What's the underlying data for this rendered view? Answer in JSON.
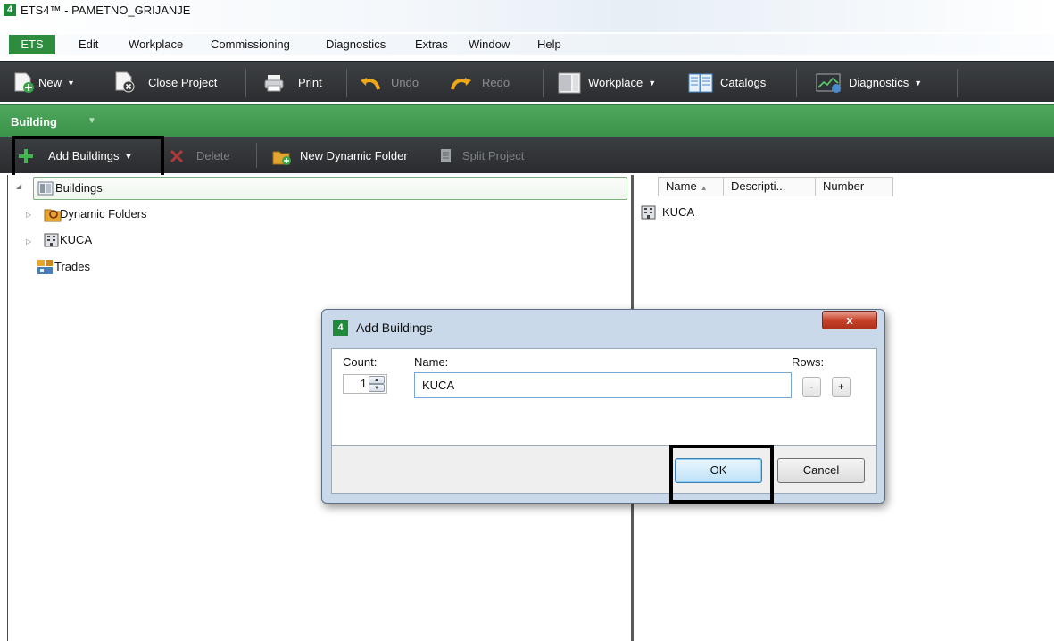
{
  "window": {
    "title": "ETS4™ - PAMETNO_GRIJANJE",
    "logo": "4"
  },
  "menu": {
    "ets_label": "ETS",
    "items": [
      "Edit",
      "Workplace",
      "Commissioning",
      "Diagnostics",
      "Extras",
      "Window",
      "Help"
    ]
  },
  "toolbar": {
    "new_label": "New",
    "close_project_label": "Close Project",
    "print_label": "Print",
    "undo_label": "Undo",
    "redo_label": "Redo",
    "workplace_label": "Workplace",
    "catalogs_label": "Catalogs",
    "diagnostics_label": "Diagnostics"
  },
  "section": {
    "title": "Building"
  },
  "subtoolbar": {
    "add_buildings_label": "Add Buildings",
    "delete_label": "Delete",
    "new_dynamic_folder_label": "New Dynamic Folder",
    "split_project_label": "Split Project"
  },
  "tree": {
    "root_label": "Buildings",
    "items": [
      {
        "label": "Dynamic Folders"
      },
      {
        "label": "KUCA"
      },
      {
        "label": "Trades"
      }
    ]
  },
  "list": {
    "columns": [
      "Name",
      "Descripti...",
      "Number"
    ],
    "rows": [
      {
        "name": "KUCA"
      }
    ]
  },
  "dialog": {
    "title": "Add Buildings",
    "close_label": "x",
    "count_label": "Count:",
    "count_value": "1",
    "name_label": "Name:",
    "name_value": "KUCA",
    "rows_label": "Rows:",
    "rows_minus_label": "-",
    "rows_plus_label": "+",
    "ok_label": "OK",
    "cancel_label": "Cancel"
  },
  "colors": {
    "accent_green": "#3b9249",
    "toolbar_dark": "#2b2d30",
    "highlight": "#000000"
  }
}
